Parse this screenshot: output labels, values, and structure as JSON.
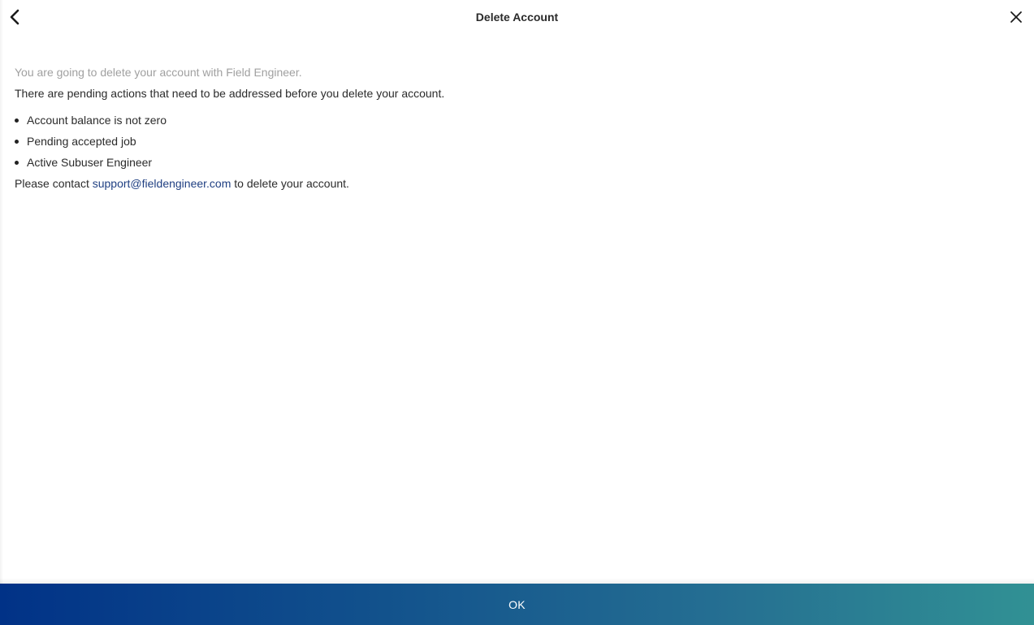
{
  "header": {
    "title": "Delete Account",
    "back_icon": "chevron-left-icon",
    "close_icon": "close-icon"
  },
  "content": {
    "intro": "You are going to delete your account with Field Engineer.",
    "pending_notice": "There are pending actions that need to be addressed before you delete your account.",
    "reasons": [
      "Account balance is not zero",
      "Pending accepted job",
      "Active Subuser Engineer"
    ],
    "contact_prefix": "Please contact ",
    "contact_email": "support@fieldengineer.com",
    "contact_suffix": " to delete your account."
  },
  "footer": {
    "ok_label": "OK"
  },
  "colors": {
    "link": "#1f3f82",
    "intro_text": "#a0a0a0",
    "gradient_start": "#013287",
    "gradient_end": "#319194"
  }
}
